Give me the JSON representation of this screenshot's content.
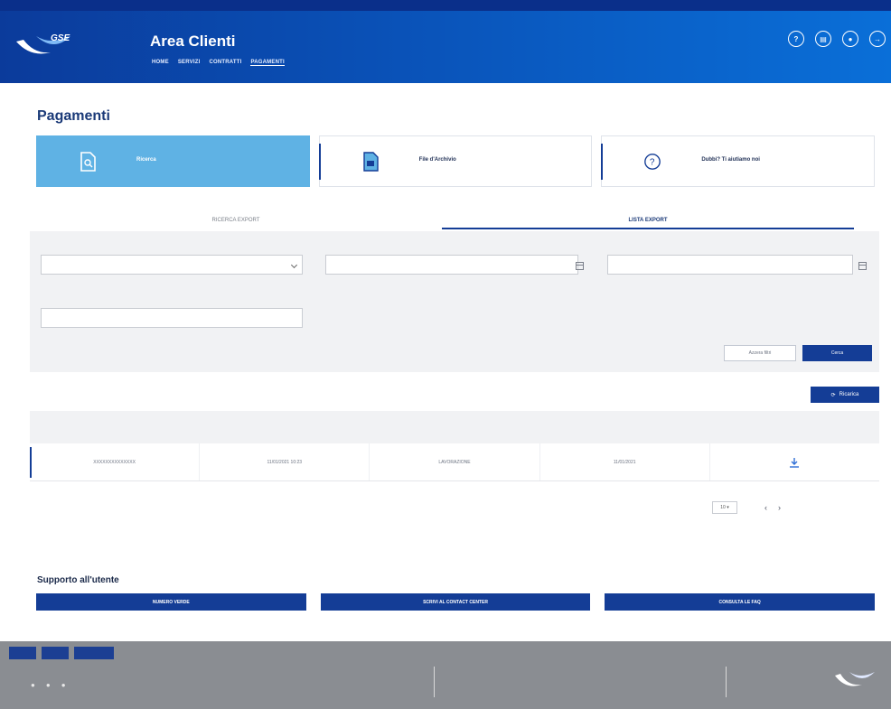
{
  "header": {
    "app_title": "Area Clienti",
    "nav": [
      "HOME",
      "SERVIZI",
      "CONTRATTI",
      "PAGAMENTI"
    ],
    "icons": [
      "help-icon",
      "documents-icon",
      "profile-icon",
      "logout-icon"
    ]
  },
  "page": {
    "title": "Pagamenti"
  },
  "cards": [
    {
      "label": "Ricerca",
      "icon": "file-search-icon"
    },
    {
      "label": "File d'Archivio",
      "icon": "file-archive-icon"
    },
    {
      "label": "Dubbi? Ti aiutiamo noi",
      "icon": "question-icon"
    }
  ],
  "tabs": [
    "RICERCA EXPORT",
    "LISTA EXPORT"
  ],
  "buttons": {
    "clear": "Azzera filtri",
    "search": "Cerca",
    "refresh": "Ricarica"
  },
  "table": {
    "row": [
      "XXXXXXXXXXXXXX",
      "11/01/2021 10:23",
      "LAVORAZIONE",
      "11/01/2021"
    ]
  },
  "pagination": {
    "page_size": "10"
  },
  "support": {
    "title": "Supporto all'utente",
    "buttons": [
      "NUMERO VERDE",
      "SCRIVI AL CONTACT CENTER",
      "CONSULTA LE FAQ"
    ]
  },
  "colors": {
    "primary": "#143d96",
    "card_active": "#5fb2e4",
    "footer_bg": "#8a8d92"
  }
}
